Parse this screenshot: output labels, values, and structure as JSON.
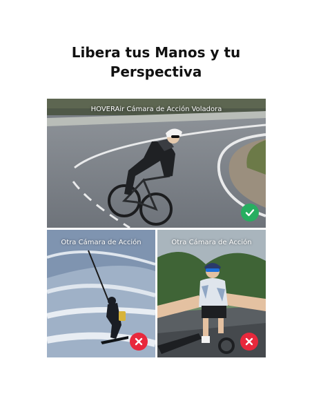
{
  "headline": {
    "line1": "Libera tus Manos y tu",
    "line2": "Perspectiva"
  },
  "panels": {
    "main": {
      "caption": "HOVERAir Cámara de Acción Voladora",
      "badge_icon": "check-icon",
      "badge_color": "#27ae60"
    },
    "left": {
      "caption": "Otra Cámara de Acción",
      "badge_icon": "close-icon",
      "badge_color": "#e8283c"
    },
    "right": {
      "caption": "Otra Cámara de Acción",
      "badge_icon": "close-icon",
      "badge_color": "#e8283c"
    }
  }
}
